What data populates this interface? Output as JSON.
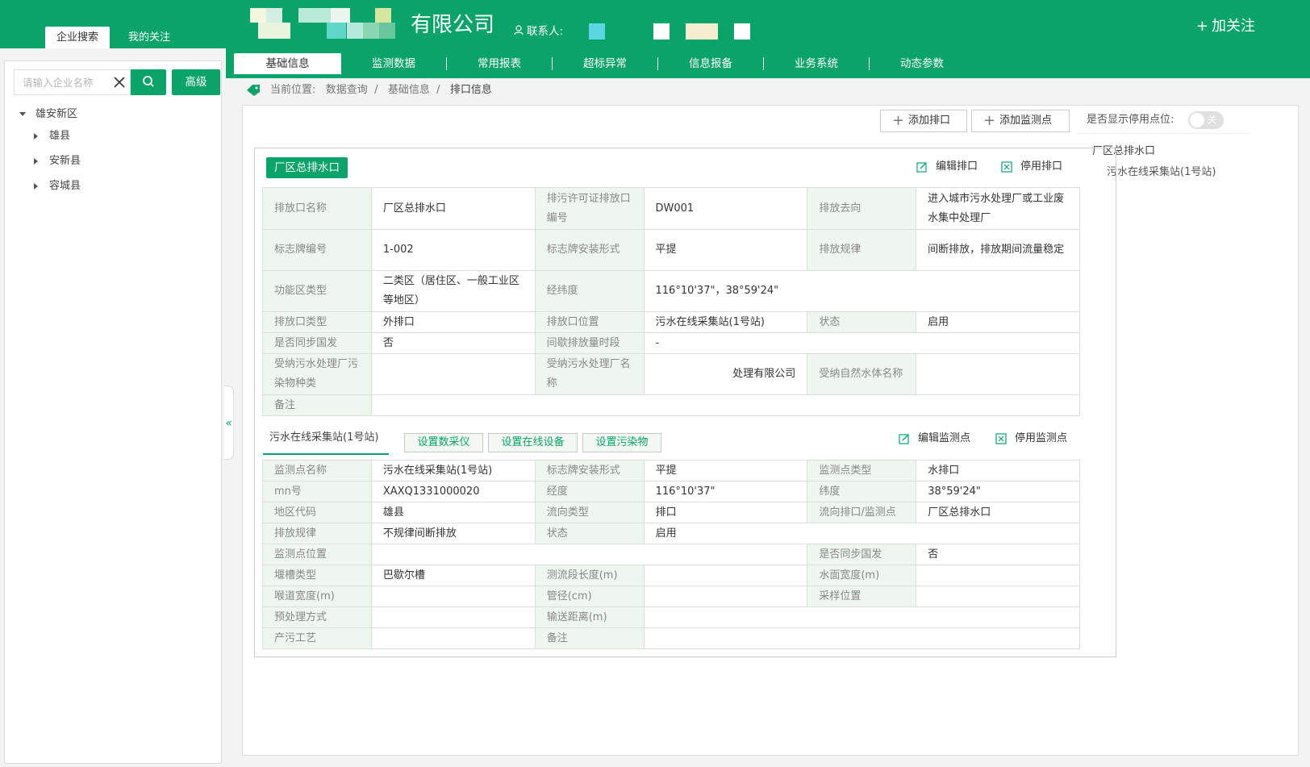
{
  "left_tabs": [
    "企业搜索",
    "我的关注"
  ],
  "search": {
    "placeholder": "请输入企业名称",
    "advanced_label": "高级"
  },
  "tree": {
    "root": "雄安新区",
    "children": [
      "雄县",
      "安新县",
      "容城县"
    ]
  },
  "header": {
    "company_suffix": "有限公司",
    "contact_label": "联系人:",
    "follow_label": "加关注"
  },
  "nav": [
    "基础信息",
    "监测数据",
    "常用报表",
    "超标异常",
    "信息报备",
    "业务系统",
    "动态参数"
  ],
  "breadcrumb": {
    "prefix": "当前位置:",
    "items": [
      "数据查询",
      "基础信息",
      "排口信息"
    ]
  },
  "toolbar": {
    "add_outlet": "添加排口",
    "add_point": "添加监测点",
    "show_disabled_label": "是否显示停用点位:",
    "toggle_label": "关",
    "toggle_on": false
  },
  "right_tree": {
    "outlet": "厂区总排水口",
    "point": "污水在线采集站(1号站)"
  },
  "outlet": {
    "tag": "厂区总排水口",
    "edit_label": "编辑排口",
    "disable_label": "停用排口",
    "rows": [
      [
        "排放口名称",
        "厂区总排水口",
        "排污许可证排放口编号",
        "DW001",
        "排放去向",
        "进入城市污水处理厂或工业废水集中处理厂"
      ],
      [
        "标志牌编号",
        "1-002",
        "标志牌安装形式",
        "平提",
        "排放规律",
        "间断排放，排放期间流量稳定"
      ],
      [
        "功能区类型",
        "二类区（居住区、一般工业区等地区）",
        "经纬度",
        "116°10'37\"，38°59'24\""
      ],
      [
        "排放口类型",
        "外排口",
        "排放口位置",
        "污水在线采集站(1号站)",
        "状态",
        "启用"
      ],
      [
        "是否同步国发",
        "否",
        "间歇排放量时段",
        "-"
      ],
      [
        "受纳污水处理厂污染物种类",
        "",
        "受纳污水处理厂名称",
        "处理有限公司",
        "受纳自然水体名称",
        ""
      ],
      [
        "备注",
        ""
      ]
    ]
  },
  "point": {
    "tab": "污水在线采集站(1号站)",
    "btn_daq": "设置数采仪",
    "btn_device": "设置在线设备",
    "btn_pollutant": "设置污染物",
    "edit_label": "编辑监测点",
    "disable_label": "停用监测点",
    "rows": [
      [
        "监测点名称",
        "污水在线采集站(1号站)",
        "标志牌安装形式",
        "平提",
        "监测点类型",
        "水排口"
      ],
      [
        "mn号",
        "XAXQ1331000020",
        "经度",
        "116°10'37\"",
        "纬度",
        "38°59'24\""
      ],
      [
        "地区代码",
        "雄县",
        "流向类型",
        "排口",
        "流向排口/监测点",
        "厂区总排水口"
      ],
      [
        "排放规律",
        "不规律间断排放",
        "状态",
        "启用"
      ],
      [
        "监测点位置",
        "",
        "是否同步国发",
        "否"
      ],
      [
        "堰槽类型",
        "巴歇尔槽",
        "测流段长度(m)",
        "",
        "水面宽度(m)",
        ""
      ],
      [
        "喉道宽度(m)",
        "",
        "管径(cm)",
        "",
        "采样位置",
        ""
      ],
      [
        "预处理方式",
        "",
        "输送距离(m)",
        ""
      ],
      [
        "产污工艺",
        "",
        "备注",
        ""
      ]
    ]
  },
  "colors": {
    "brand": "#0aa36a",
    "key_bg": "#eef6ef"
  }
}
